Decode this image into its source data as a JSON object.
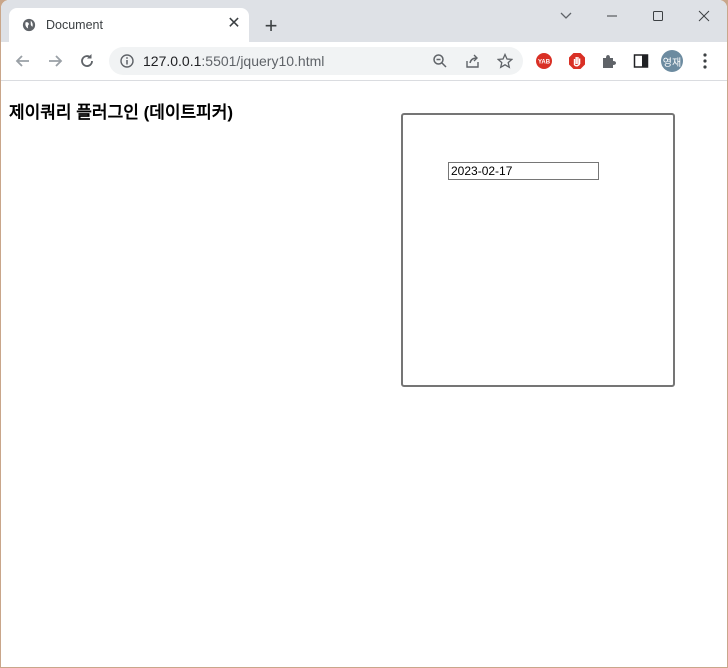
{
  "browser": {
    "tab_title": "Document",
    "url_host": "127.0.0.1",
    "url_rest": ":5501/jquery10.html",
    "profile_initials": "영재",
    "extensions": [
      "YAB",
      "stop-hand",
      "puzzle",
      "side-panel"
    ]
  },
  "page": {
    "heading": "제이쿼리 플러그인 (데이트피커)",
    "datepicker": {
      "value": "2023-02-17"
    }
  }
}
